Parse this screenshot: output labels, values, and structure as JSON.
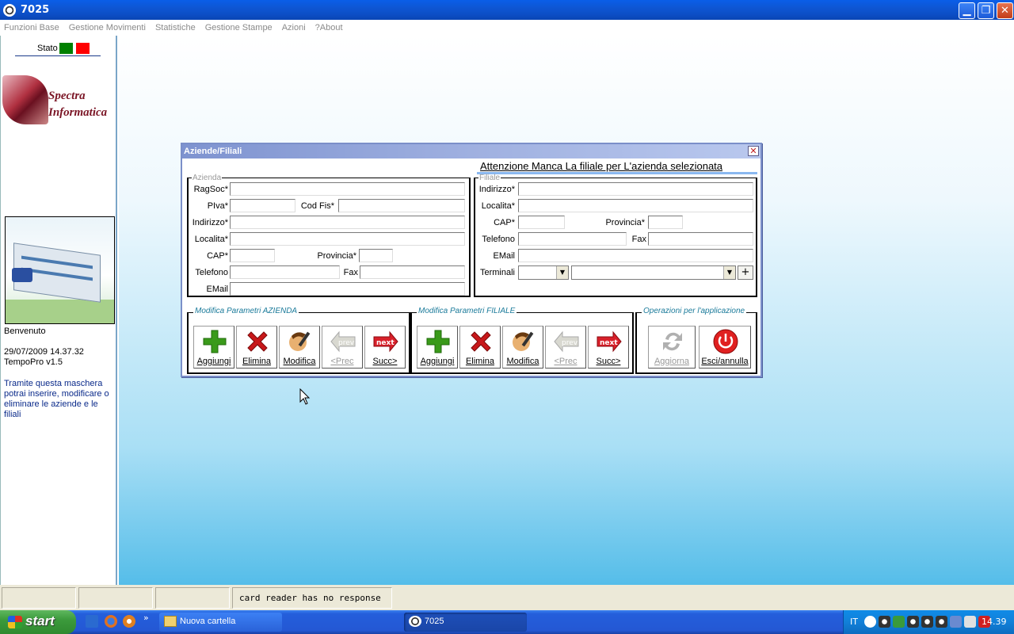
{
  "window": {
    "title": "7025"
  },
  "menu": [
    "Funzioni Base",
    "Gestione Movimenti",
    "Statistiche",
    "Gestione Stampe",
    "Azioni",
    "?About"
  ],
  "left_panel": {
    "stato_label": "Stato",
    "stato_colors": [
      "#008000",
      "#ff0000"
    ],
    "logo_text": [
      "Spectra",
      "Informatica"
    ],
    "welcome": "Benvenuto",
    "datetime": "29/07/2009 14.37.32",
    "version": "TempoPro v1.5",
    "description": "Tramite questa maschera potrai inserire, modificare o eliminare le aziende e le filiali"
  },
  "dialog": {
    "title": "Aziende/Filiali",
    "warning": "Attenzione Manca La filiale per L'azienda selezionata",
    "azienda": {
      "legend": "Azienda",
      "ragsoc_label": "RagSoc*",
      "piva_label": "PIva*",
      "codfis_label": "Cod Fis*",
      "indirizzo_label": "Indirizzo*",
      "localita_label": "Localita*",
      "cap_label": "CAP*",
      "provincia_label": "Provincia*",
      "telefono_label": "Telefono",
      "fax_label": "Fax",
      "email_label": "EMail"
    },
    "filiale": {
      "legend": "Filiale",
      "indirizzo_label": "Indirizzo*",
      "localita_label": "Localita*",
      "cap_label": "CAP*",
      "provincia_label": "Provincia*",
      "telefono_label": "Telefono",
      "fax_label": "Fax",
      "email_label": "EMail",
      "terminali_label": "Terminali",
      "plus_label": "+"
    },
    "group_azienda": {
      "legend": "Modifica Parametri AZIENDA",
      "buttons": [
        "Aggiungi",
        "Elimina",
        "Modifica",
        "<Prec",
        "Succ>"
      ]
    },
    "group_filiale": {
      "legend": "Modifica Parametri FILIALE",
      "buttons": [
        "Aggiungi",
        "Elimina",
        "Modifica",
        "<Prec",
        "Succ>"
      ]
    },
    "group_app": {
      "legend": "Operazioni per l'applicazione",
      "buttons": [
        "Aggiorna",
        "Esci/annulla"
      ]
    },
    "icon_text": {
      "prev": "prev",
      "next": "next"
    }
  },
  "statusbar": {
    "message": "card reader has no response"
  },
  "taskbar": {
    "start": "start",
    "tasks": [
      "Nuova cartella",
      "7025"
    ],
    "lang": "IT",
    "clock": "14.39"
  }
}
